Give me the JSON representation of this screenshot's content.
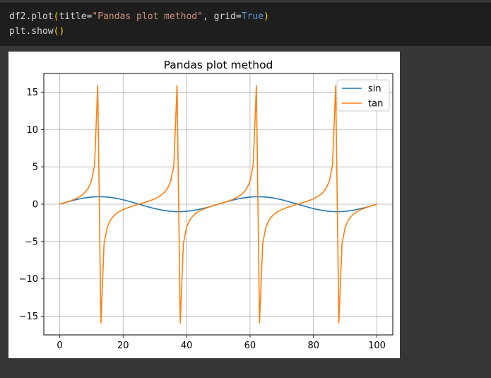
{
  "code": {
    "line1": {
      "fn": "df2.plot",
      "open_paren": "(",
      "arg1_name": "title=",
      "arg1_value": "\"Pandas plot method\"",
      "sep": ", ",
      "arg2_name": "grid=",
      "arg2_value": "True",
      "close_paren": ")"
    },
    "line2": {
      "fn": "plt.show",
      "parens": "()"
    }
  },
  "colors": {
    "sin": "#1f77b4",
    "tan": "#ff7f0e",
    "grid": "#b0b0b0",
    "string_token": "#ce9178",
    "keyword_token": "#569cd6",
    "paren_token": "#ffd700"
  },
  "chart_data": {
    "type": "line",
    "title": "Pandas plot method",
    "xlabel": "",
    "ylabel": "",
    "xlim": [
      -5,
      105
    ],
    "ylim": [
      -17.5,
      17.5
    ],
    "grid": true,
    "legend_position": "top-right",
    "xticks": [
      0,
      20,
      40,
      60,
      80,
      100
    ],
    "xtick_labels": [
      "0",
      "20",
      "40",
      "60",
      "80",
      "100"
    ],
    "yticks": [
      -15,
      -10,
      -5,
      0,
      5,
      10,
      15
    ],
    "ytick_labels": [
      "−15",
      "−10",
      "−5",
      "0",
      "5",
      "10",
      "15"
    ],
    "x": [
      0,
      1,
      2,
      3,
      4,
      5,
      6,
      7,
      8,
      9,
      10,
      11,
      12,
      13,
      14,
      15,
      16,
      17,
      18,
      19,
      20,
      21,
      22,
      23,
      24,
      25,
      26,
      27,
      28,
      29,
      30,
      31,
      32,
      33,
      34,
      35,
      36,
      37,
      38,
      39,
      40,
      41,
      42,
      43,
      44,
      45,
      46,
      47,
      48,
      49,
      50,
      51,
      52,
      53,
      54,
      55,
      56,
      57,
      58,
      59,
      60,
      61,
      62,
      63,
      64,
      65,
      66,
      67,
      68,
      69,
      70,
      71,
      72,
      73,
      74,
      75,
      76,
      77,
      78,
      79,
      80,
      81,
      82,
      83,
      84,
      85,
      86,
      87,
      88,
      89,
      90,
      91,
      92,
      93,
      94,
      95,
      96,
      97,
      98,
      99,
      100
    ],
    "series": [
      {
        "name": "sin",
        "values": [
          0,
          0.125,
          0.249,
          0.368,
          0.482,
          0.588,
          0.685,
          0.771,
          0.844,
          0.905,
          0.951,
          0.982,
          0.998,
          0.998,
          0.982,
          0.951,
          0.905,
          0.844,
          0.771,
          0.685,
          0.588,
          0.482,
          0.368,
          0.249,
          0.125,
          0,
          -0.125,
          -0.249,
          -0.368,
          -0.482,
          -0.588,
          -0.685,
          -0.771,
          -0.844,
          -0.905,
          -0.951,
          -0.982,
          -0.998,
          -0.998,
          -0.982,
          -0.951,
          -0.905,
          -0.844,
          -0.771,
          -0.685,
          -0.588,
          -0.482,
          -0.368,
          -0.249,
          -0.125,
          0,
          0.125,
          0.249,
          0.368,
          0.482,
          0.588,
          0.685,
          0.771,
          0.844,
          0.905,
          0.951,
          0.982,
          0.998,
          0.998,
          0.982,
          0.951,
          0.905,
          0.844,
          0.771,
          0.685,
          0.588,
          0.482,
          0.368,
          0.249,
          0.125,
          0,
          -0.125,
          -0.249,
          -0.368,
          -0.482,
          -0.588,
          -0.685,
          -0.771,
          -0.844,
          -0.905,
          -0.951,
          -0.982,
          -0.998,
          -0.998,
          -0.982,
          -0.951,
          -0.905,
          -0.844,
          -0.771,
          -0.685,
          -0.588,
          -0.482,
          -0.368,
          -0.249,
          -0.125,
          0
        ]
      },
      {
        "name": "tan",
        "values": [
          0,
          0.126,
          0.257,
          0.395,
          0.551,
          0.727,
          0.94,
          1.211,
          1.576,
          2.124,
          3.077,
          5.242,
          15.89,
          -15.89,
          -5.242,
          -3.077,
          -2.124,
          -1.576,
          -1.211,
          -0.94,
          -0.727,
          -0.551,
          -0.395,
          -0.257,
          -0.126,
          0,
          0.126,
          0.257,
          0.395,
          0.551,
          0.727,
          0.94,
          1.211,
          1.576,
          2.124,
          3.077,
          5.242,
          15.89,
          -15.89,
          -5.242,
          -3.077,
          -2.124,
          -1.576,
          -1.211,
          -0.94,
          -0.727,
          -0.551,
          -0.395,
          -0.257,
          -0.126,
          0,
          0.126,
          0.257,
          0.395,
          0.551,
          0.727,
          0.94,
          1.211,
          1.576,
          2.124,
          3.077,
          5.242,
          15.89,
          -15.89,
          -5.242,
          -3.077,
          -2.124,
          -1.576,
          -1.211,
          -0.94,
          -0.727,
          -0.551,
          -0.395,
          -0.257,
          -0.126,
          0,
          0.126,
          0.257,
          0.395,
          0.551,
          0.727,
          0.94,
          1.211,
          1.576,
          2.124,
          3.077,
          5.242,
          15.89,
          -15.89,
          -5.242,
          -3.077,
          -2.124,
          -1.576,
          -1.211,
          -0.94,
          -0.727,
          -0.551,
          -0.395,
          -0.257,
          -0.126,
          0
        ]
      }
    ]
  }
}
